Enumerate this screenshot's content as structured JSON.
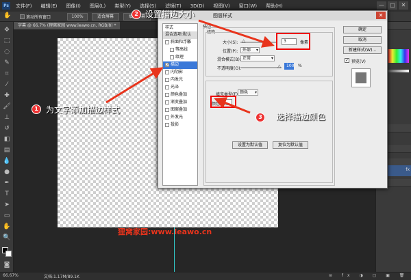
{
  "menubar": {
    "logo": "Ps",
    "items": [
      "文件(F)",
      "编辑(E)",
      "图像(I)",
      "图层(L)",
      "类型(Y)",
      "选择(S)",
      "滤镜(T)",
      "3D(D)",
      "视图(V)",
      "窗口(W)",
      "帮助(H)"
    ],
    "window_controls": [
      "—",
      "□",
      "✕"
    ]
  },
  "optionsbar": {
    "scroll_all": "滚动所有窗口",
    "zoom": "100%",
    "fit_screen": "适合屏幕",
    "fill_screen": "填充屏幕"
  },
  "document_tab": "字幕 @ 66.7% (狸窝家园 www.leawo.cn, RGB/8) *",
  "watermark": "狸窝家园:www.leawo.cn",
  "status": {
    "zoom": "66.67%",
    "doc_info": "文档:1.17M/89.1K"
  },
  "layer_style_dialog": {
    "title": "图层样式",
    "styles_header": "样式",
    "blend_options": "混合选项:默认",
    "styles": [
      {
        "label": "斜面和浮雕",
        "checked": false,
        "indent": false
      },
      {
        "label": "等高线",
        "checked": false,
        "indent": true
      },
      {
        "label": "纹理",
        "checked": false,
        "indent": true
      },
      {
        "label": "描边",
        "checked": true,
        "indent": false,
        "selected": true
      },
      {
        "label": "内阴影",
        "checked": false,
        "indent": false
      },
      {
        "label": "内发光",
        "checked": false,
        "indent": false
      },
      {
        "label": "光泽",
        "checked": false,
        "indent": false
      },
      {
        "label": "颜色叠加",
        "checked": false,
        "indent": false
      },
      {
        "label": "渐变叠加",
        "checked": false,
        "indent": false
      },
      {
        "label": "图案叠加",
        "checked": false,
        "indent": false
      },
      {
        "label": "外发光",
        "checked": false,
        "indent": false
      },
      {
        "label": "投影",
        "checked": false,
        "indent": false
      }
    ],
    "stroke_group": "描边",
    "structure_group": "结构",
    "size_label": "大小(S):",
    "size_value": "3",
    "size_unit": "像素",
    "position_label": "位置(P):",
    "position_value": "外部",
    "blend_mode_label": "混合模式(B):",
    "blend_mode_value": "正常",
    "opacity_label": "不透明度(O):",
    "opacity_value": "100",
    "opacity_unit": "%",
    "fill_type_label": "填充类型(F):",
    "fill_type_value": "颜色",
    "color_label": "颜色:",
    "stroke_color": "#ffffff",
    "set_default": "设置为默认值",
    "reset_default": "复位为默认值",
    "ok": "确定",
    "cancel": "取消",
    "new_style": "新建样式(W)...",
    "preview": "预览(V)",
    "preview_checked": true
  },
  "annotations": [
    {
      "number": "1",
      "text": "为文字添加描边样式"
    },
    {
      "number": "2",
      "text": "设置描边大小"
    },
    {
      "number": "3",
      "text": "选择描边颜色"
    }
  ],
  "colors": {
    "annotation_red": "#e8341c",
    "selected_blue": "#3a78d8",
    "guide_cyan": "#33cccc"
  }
}
